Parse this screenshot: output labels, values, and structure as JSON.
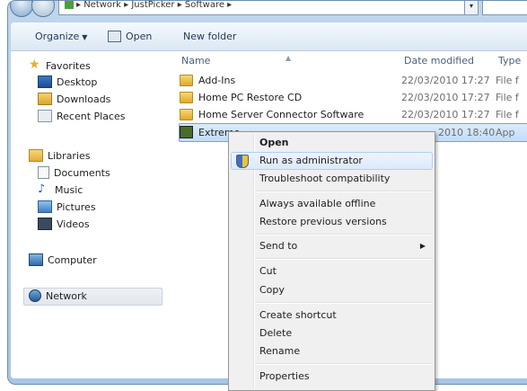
{
  "address_bar": {
    "path": "▸ Network ▸ JustPicker ▸ Software ▸"
  },
  "toolbar": {
    "organize_label": "Organize",
    "open_label": "Open",
    "new_folder_label": "New folder"
  },
  "navpane": {
    "favorites": {
      "label": "Favorites",
      "items": [
        "Desktop",
        "Downloads",
        "Recent Places"
      ]
    },
    "libraries": {
      "label": "Libraries",
      "items": [
        "Documents",
        "Music",
        "Pictures",
        "Videos"
      ]
    },
    "computer_label": "Computer",
    "network_label": "Network"
  },
  "columns": {
    "name": "Name",
    "date": "Date modified",
    "type": "Type"
  },
  "files": [
    {
      "name": "Add-Ins",
      "date": "22/03/2010 17:27",
      "type": "File f",
      "icon": "folder-icon"
    },
    {
      "name": "Home PC Restore CD",
      "date": "22/03/2010 17:27",
      "type": "File f",
      "icon": "folder-icon"
    },
    {
      "name": "Home Server Connector Software",
      "date": "22/03/2010 17:27",
      "type": "File f",
      "icon": "folder-icon"
    },
    {
      "name": "Extreme",
      "date": "2010 18:40",
      "type": "App",
      "icon": "application-icon"
    }
  ],
  "context_menu": {
    "open": "Open",
    "run_as_admin": "Run as administrator",
    "troubleshoot": "Troubleshoot compatibility",
    "always_offline": "Always available offline",
    "restore_previous": "Restore previous versions",
    "send_to": "Send to",
    "cut": "Cut",
    "copy": "Copy",
    "create_shortcut": "Create shortcut",
    "delete": "Delete",
    "rename": "Rename",
    "properties": "Properties"
  }
}
